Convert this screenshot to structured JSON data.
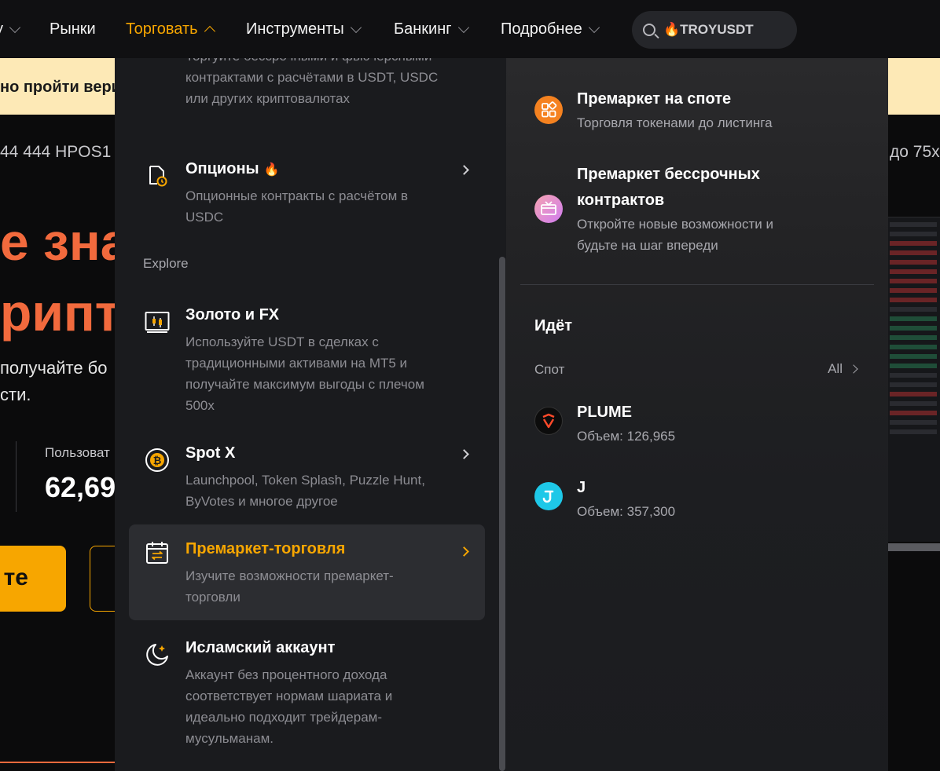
{
  "nav": {
    "items": [
      {
        "label": "у",
        "active": false,
        "chevron": true
      },
      {
        "label": "Рынки",
        "active": false,
        "chevron": false
      },
      {
        "label": "Торговать",
        "active": true,
        "chevron": true
      },
      {
        "label": "Инструменты",
        "active": false,
        "chevron": true
      },
      {
        "label": "Банкинг",
        "active": false,
        "chevron": true
      },
      {
        "label": "Подробнее",
        "active": false,
        "chevron": true
      }
    ],
    "search_value": "🔥TROYUSDT"
  },
  "background": {
    "banner_text": "но пройти вери",
    "ticker_left": "44 444 HPOS1",
    "ticker_right": "до 75х",
    "hero_line1": "е зна",
    "hero_line2": "рипт",
    "hero_sub1": "получайте бо",
    "hero_sub2": "сти.",
    "users_label": "Пользоват",
    "users_value": "62,69",
    "cta_label": "те"
  },
  "menu": {
    "top_cut_desc": "Торгуйте бессрочными и фьючерсными контрактами с расчётами в USDT, USDC или других криптовалютах",
    "options": {
      "title": "Опционы",
      "fire": "🔥",
      "desc": "Опционные контракты с расчётом в USDC"
    },
    "explore_label": "Explore",
    "gold_fx": {
      "title": "Золото и FX",
      "desc": "Используйте USDT в сделках с традиционными активами на MT5 и получайте максимум выгоды с плечом 500x"
    },
    "spot_x": {
      "title": "Spot X",
      "desc": "Launchpool, Token Splash, Puzzle Hunt, ByVotes и многое другое"
    },
    "premarket": {
      "title": "Премаркет-торговля",
      "desc": "Изучите возможности премаркет-торговли"
    },
    "islamic": {
      "title": "Исламский аккаунт",
      "desc": "Аккаунт без процентного дохода соответствует нормам шариата и идеально подходит трейдерам-мусульманам."
    }
  },
  "right": {
    "spot_premarket": {
      "title": "Премаркет на споте",
      "desc": "Торговля токенами до листинга"
    },
    "perp_premarket": {
      "title_line1": "Премаркет бессрочных",
      "title_line2": "контрактов",
      "desc_line1": "Откройте новые возможности и",
      "desc_line2": "будьте на шаг впереди"
    },
    "ongoing_title": "Идёт",
    "spot_label": "Спот",
    "all_label": "All",
    "coins": [
      {
        "name": "PLUME",
        "volume": "Объем: 126,965"
      },
      {
        "name": "J",
        "volume": "Объем: 357,300"
      }
    ]
  },
  "colors": {
    "accent": "#f7a600",
    "hero": "#f26a3d",
    "panel": "#1a1b1e"
  }
}
